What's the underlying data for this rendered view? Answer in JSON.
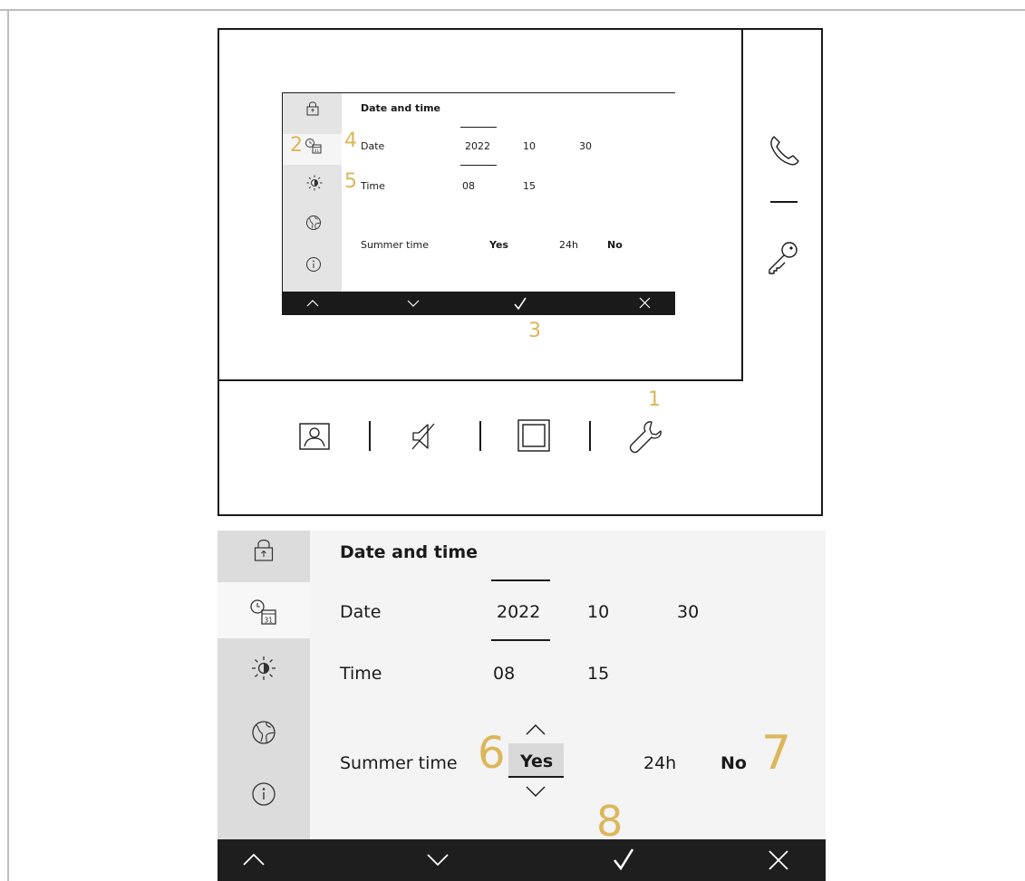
{
  "screen": {
    "title": "Date and time",
    "date_label": "Date",
    "date_year": "2022",
    "date_month": "10",
    "date_day": "30",
    "time_label": "Time",
    "time_hour": "08",
    "time_minute": "15",
    "summer_label": "Summer time",
    "summer_value": "Yes",
    "format_label": "24h",
    "format_value": "No"
  },
  "sidebar_icons": [
    "lock-icon",
    "clock-calendar-icon",
    "brightness-icon",
    "globe-icon",
    "info-icon"
  ],
  "bottom_bar_icons": [
    "up-icon",
    "down-icon",
    "check-icon",
    "close-icon"
  ],
  "device_side_icons": [
    "phone-icon",
    "key-icon"
  ],
  "device_bottom_icons": [
    "contacts-icon",
    "mute-icon",
    "screen-icon",
    "settings-wrench-icon"
  ],
  "calendar_day": "31",
  "callouts": {
    "c1": "1",
    "c2": "2",
    "c3": "3",
    "c4": "4",
    "c5": "5",
    "c6": "6",
    "c7": "7",
    "c8": "8"
  },
  "colors": {
    "callout": "#dcb65a",
    "bar": "#1e1e1e",
    "sidebar": "#dcdcdc",
    "content": "#f4f4f4"
  }
}
